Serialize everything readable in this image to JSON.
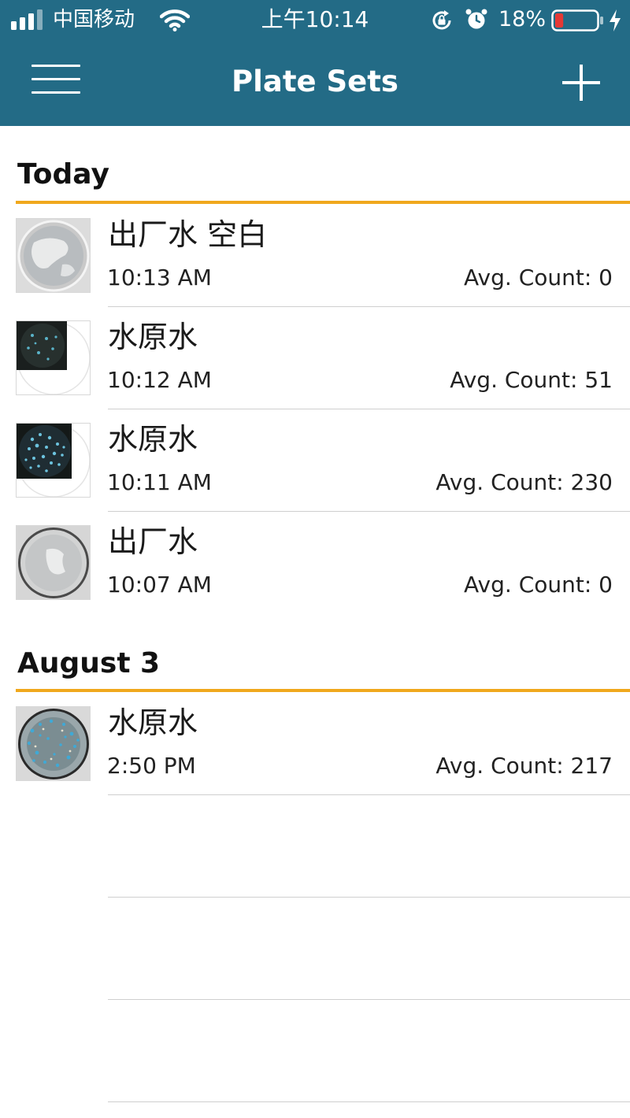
{
  "status_bar": {
    "carrier": "中国移动",
    "time": "上午10:14",
    "battery_percent": "18%",
    "battery_level": 0.18,
    "signal_bars": 4,
    "icons": [
      "signal-icon",
      "wifi-icon",
      "rotation-lock-icon",
      "alarm-icon",
      "battery-icon",
      "charging-bolt-icon"
    ]
  },
  "nav": {
    "title": "Plate Sets",
    "menu_icon": "hamburger-menu-icon",
    "add_icon": "plus-icon"
  },
  "colors": {
    "nav_background": "#236b86",
    "section_rule": "#f0a81d",
    "battery_low": "#e53935"
  },
  "sections": [
    {
      "header": "Today",
      "rows": [
        {
          "title": "出厂水 空白",
          "time": "10:13 AM",
          "count": "Avg. Count: 0",
          "thumb": "blank-plate"
        },
        {
          "title": "水原水",
          "time": "10:12 AM",
          "count": "Avg. Count: 51",
          "thumb": "dark-plate-few-colonies"
        },
        {
          "title": "水原水",
          "time": "10:11 AM",
          "count": "Avg. Count: 230",
          "thumb": "dark-plate-many-colonies"
        },
        {
          "title": "出厂水",
          "time": "10:07 AM",
          "count": "Avg. Count: 0",
          "thumb": "blank-plate"
        }
      ]
    },
    {
      "header": "August 3",
      "rows": [
        {
          "title": "水原水",
          "time": "2:50 PM",
          "count": "Avg. Count: 217",
          "thumb": "clear-plate-colonies"
        }
      ]
    }
  ]
}
